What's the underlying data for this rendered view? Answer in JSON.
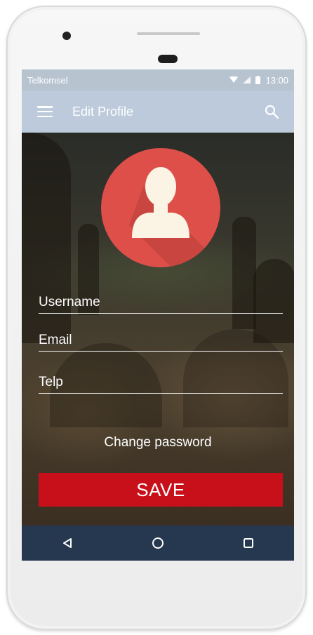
{
  "status_bar": {
    "carrier": "Telkomsel",
    "time": "13:00"
  },
  "app_bar": {
    "title": "Edit Profile",
    "menu_icon": "hamburger-menu-icon",
    "search_icon": "search-icon"
  },
  "avatar": {
    "icon": "user-silhouette-icon",
    "color": "#de4f4a"
  },
  "form": {
    "username_label": "Username",
    "email_label": "Email",
    "telp_label": "Telp"
  },
  "change_password_label": "Change password",
  "save_label": "SAVE",
  "colors": {
    "app_bar": "#bccadc",
    "save_button": "#c8101a",
    "nav_bar": "#26384f"
  },
  "nav_bar": {
    "back_icon": "back-triangle-icon",
    "home_icon": "home-circle-icon",
    "recents_icon": "recents-square-icon"
  }
}
